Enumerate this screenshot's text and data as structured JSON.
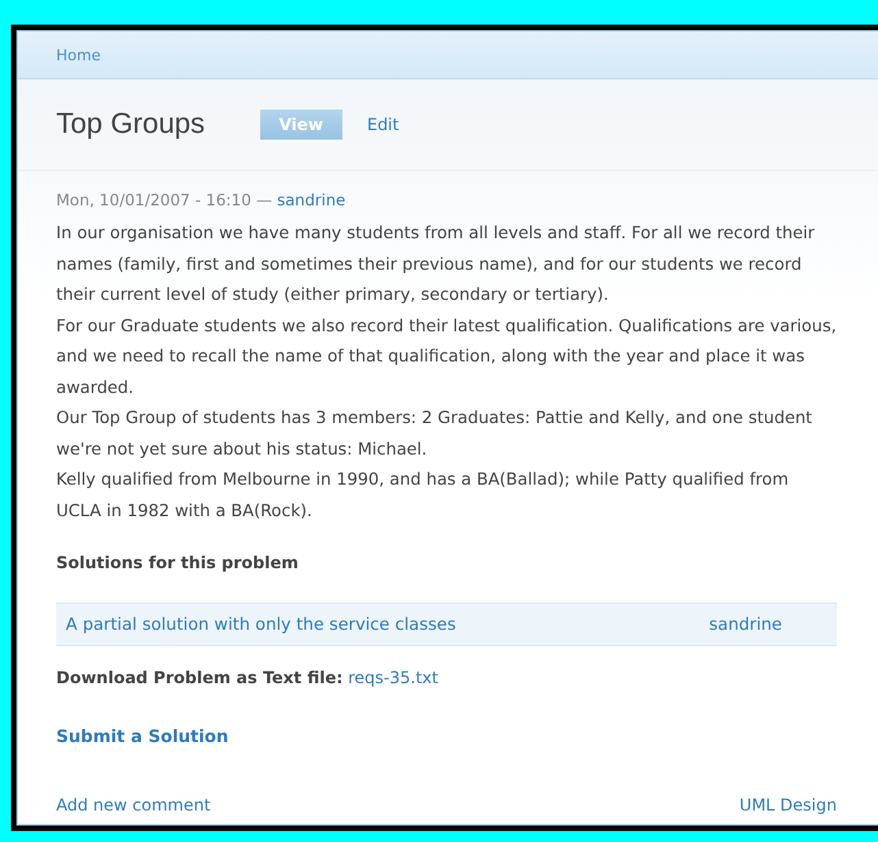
{
  "breadcrumb": "Home",
  "title": "Top Groups",
  "tabs": [
    {
      "label": "View",
      "selected": true
    },
    {
      "label": "Edit",
      "selected": false
    }
  ],
  "meta": {
    "date": "Mon, 10/01/2007 - 16:10 —",
    "author": "sandrine"
  },
  "body": [
    "In our organisation we have many students from all levels and staff. For all we record their names (family, first and sometimes their previous name), and for our students we record their current level of study (either primary, secondary or tertiary).",
    "For our Graduate students we also record their latest qualification. Qualifications are various, and we need to recall the name of that qualification, along with the year and place it was awarded.",
    "Our Top Group of students has 3 members: 2 Graduates: Pattie and Kelly, and one student we're not yet sure about his status: Michael.",
    "Kelly qualified from Melbourne in 1990, and has a BA(Ballad); while Patty qualified from UCLA in 1982 with a BA(Rock)."
  ],
  "solutions": {
    "heading": "Solutions for this problem",
    "rows": [
      {
        "title": "A partial solution with only the service classes",
        "author": "sandrine"
      }
    ]
  },
  "download": {
    "label": "Download Problem as Text file:",
    "file": "reqs-35.txt"
  },
  "submit": "Submit a Solution",
  "links": [
    "Add new comment",
    "UML Design"
  ]
}
